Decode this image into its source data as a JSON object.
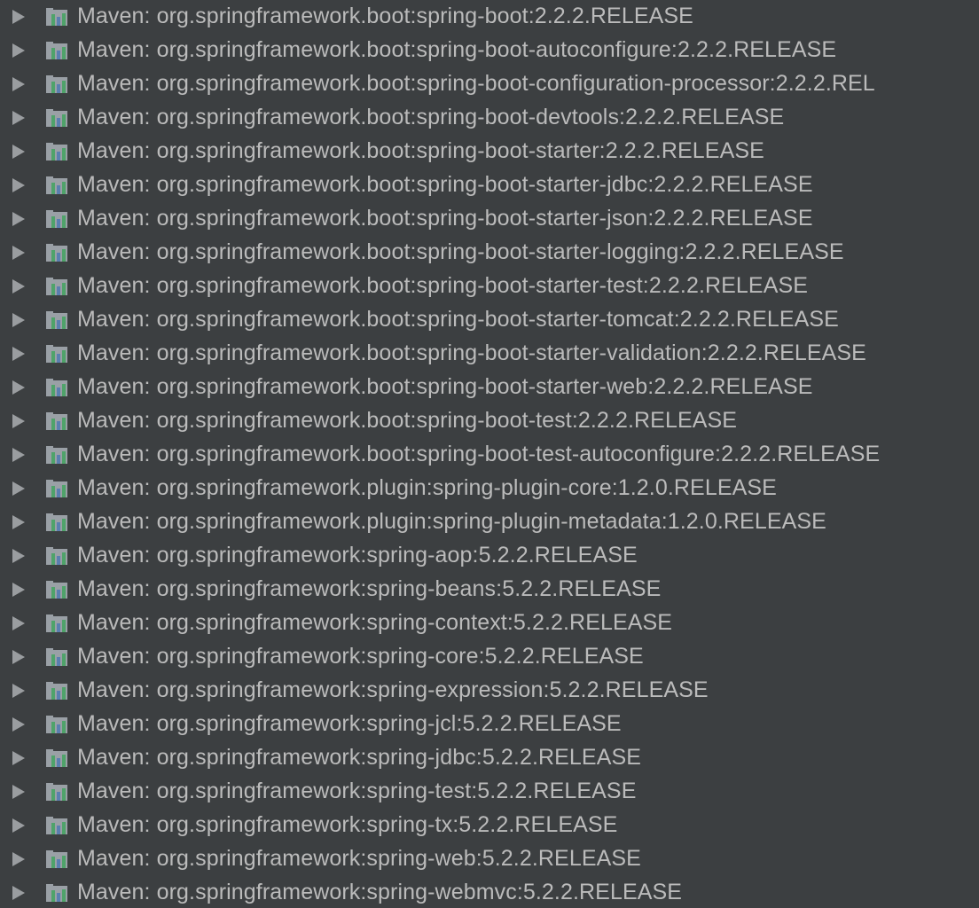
{
  "tree": {
    "items": [
      {
        "label": "Maven: org.springframework.boot:spring-boot:2.2.2.RELEASE"
      },
      {
        "label": "Maven: org.springframework.boot:spring-boot-autoconfigure:2.2.2.RELEASE"
      },
      {
        "label": "Maven: org.springframework.boot:spring-boot-configuration-processor:2.2.2.REL"
      },
      {
        "label": "Maven: org.springframework.boot:spring-boot-devtools:2.2.2.RELEASE"
      },
      {
        "label": "Maven: org.springframework.boot:spring-boot-starter:2.2.2.RELEASE"
      },
      {
        "label": "Maven: org.springframework.boot:spring-boot-starter-jdbc:2.2.2.RELEASE"
      },
      {
        "label": "Maven: org.springframework.boot:spring-boot-starter-json:2.2.2.RELEASE"
      },
      {
        "label": "Maven: org.springframework.boot:spring-boot-starter-logging:2.2.2.RELEASE"
      },
      {
        "label": "Maven: org.springframework.boot:spring-boot-starter-test:2.2.2.RELEASE"
      },
      {
        "label": "Maven: org.springframework.boot:spring-boot-starter-tomcat:2.2.2.RELEASE"
      },
      {
        "label": "Maven: org.springframework.boot:spring-boot-starter-validation:2.2.2.RELEASE"
      },
      {
        "label": "Maven: org.springframework.boot:spring-boot-starter-web:2.2.2.RELEASE"
      },
      {
        "label": "Maven: org.springframework.boot:spring-boot-test:2.2.2.RELEASE"
      },
      {
        "label": "Maven: org.springframework.boot:spring-boot-test-autoconfigure:2.2.2.RELEASE"
      },
      {
        "label": "Maven: org.springframework.plugin:spring-plugin-core:1.2.0.RELEASE"
      },
      {
        "label": "Maven: org.springframework.plugin:spring-plugin-metadata:1.2.0.RELEASE"
      },
      {
        "label": "Maven: org.springframework:spring-aop:5.2.2.RELEASE"
      },
      {
        "label": "Maven: org.springframework:spring-beans:5.2.2.RELEASE"
      },
      {
        "label": "Maven: org.springframework:spring-context:5.2.2.RELEASE"
      },
      {
        "label": "Maven: org.springframework:spring-core:5.2.2.RELEASE"
      },
      {
        "label": "Maven: org.springframework:spring-expression:5.2.2.RELEASE"
      },
      {
        "label": "Maven: org.springframework:spring-jcl:5.2.2.RELEASE"
      },
      {
        "label": "Maven: org.springframework:spring-jdbc:5.2.2.RELEASE"
      },
      {
        "label": "Maven: org.springframework:spring-test:5.2.2.RELEASE"
      },
      {
        "label": "Maven: org.springframework:spring-tx:5.2.2.RELEASE"
      },
      {
        "label": "Maven: org.springframework:spring-web:5.2.2.RELEASE"
      },
      {
        "label": "Maven: org.springframework:spring-webmvc:5.2.2.RELEASE"
      }
    ],
    "expand_icon": "chevron-right-icon",
    "item_icon": "library-icon",
    "colors": {
      "background": "#3c3f41",
      "text": "#bbbbbb",
      "arrow": "#9a9da0",
      "icon_shelf": "#9aa0a6",
      "icon_bar": "#4fa36a"
    }
  }
}
